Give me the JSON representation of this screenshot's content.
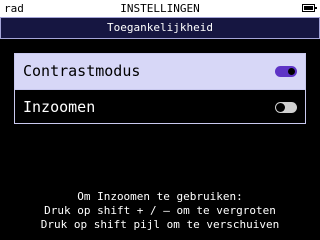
{
  "status_bar": {
    "mode": "rad",
    "title": "INSTELLINGEN",
    "battery_icon": "battery-full-icon"
  },
  "header": {
    "title": "Toegankelijkheid"
  },
  "menu": {
    "items": [
      {
        "label": "Contrastmodus",
        "toggle": "on",
        "selected": true
      },
      {
        "label": "Inzoomen",
        "toggle": "off",
        "selected": false
      }
    ]
  },
  "help": {
    "lines": [
      "Om Inzoomen te gebruiken:",
      "Druk op shift + / – om te vergroten",
      "Druk op shift pijl om te verschuiven"
    ]
  },
  "colors": {
    "header_bg": "#161641",
    "header_border": "#a5a5d8",
    "selected_bg": "#d7d7f7",
    "toggle_on": "#5e34c6",
    "toggle_off": "#d0d0d0"
  }
}
